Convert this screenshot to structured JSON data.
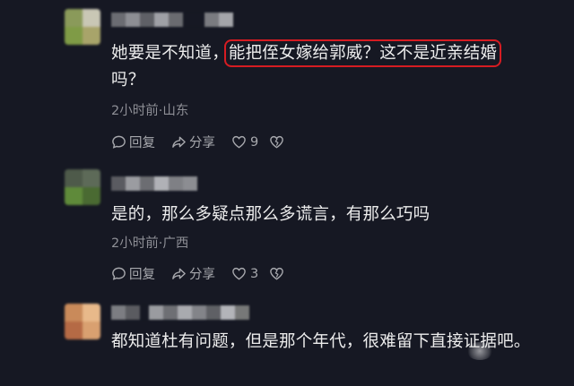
{
  "comments": [
    {
      "text_before": "她要是不知道，",
      "text_highlight": "能把侄女嫁给郭威？这不是近亲结婚",
      "text_after": "吗？",
      "meta": "2小时前·山东",
      "reply_label": "回复",
      "share_label": "分享",
      "likes": "9"
    },
    {
      "text": "是的，那么多疑点那么多谎言，有那么巧吗",
      "meta": "2小时前·广西",
      "reply_label": "回复",
      "share_label": "分享",
      "likes": "3"
    },
    {
      "text": "都知道杜有问题，但是那个年代，很难留下直接证据吧。"
    }
  ],
  "icons": {
    "reply": "comment-bubble-icon",
    "share": "share-arrow-icon",
    "like": "heart-icon",
    "dislike": "broken-heart-icon"
  },
  "colors": {
    "background": "#161823",
    "text": "#ececec",
    "meta": "#8e8f96",
    "highlight_box": "#d61c22"
  }
}
